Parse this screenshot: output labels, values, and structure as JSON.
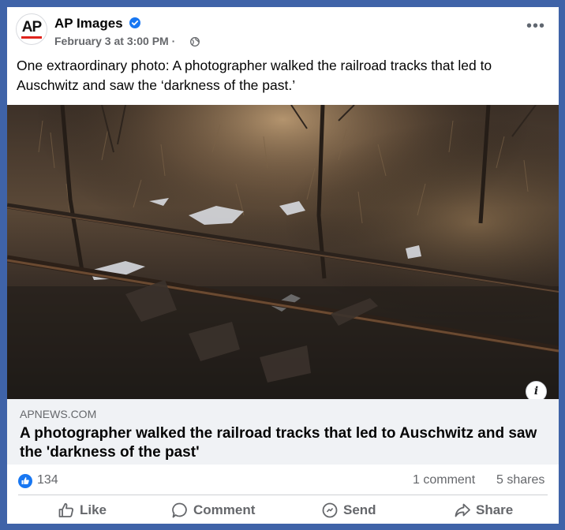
{
  "post": {
    "page_name": "AP Images",
    "avatar_text": "AP",
    "date": "February 3 at 3:00 PM ·",
    "more_label": "•••",
    "text": "One extraordinary photo: A photographer walked the railroad tracks that led to Auschwitz and saw the ‘darkness of the past.’",
    "image_icon": "info-icon",
    "info_label": "i"
  },
  "link": {
    "domain": "APNEWS.COM",
    "title": "A photographer walked the railroad tracks that led to Auschwitz and saw the 'darkness of the past'"
  },
  "stats": {
    "likes": "134",
    "comments": "1 comment",
    "shares": "5 shares"
  },
  "actions": {
    "like": "Like",
    "comment": "Comment",
    "send": "Send",
    "share": "Share"
  },
  "colors": {
    "frame": "#3f63a8",
    "facebook_blue": "#1877f2",
    "ap_red": "#e0231c",
    "muted_text": "#65676b"
  }
}
